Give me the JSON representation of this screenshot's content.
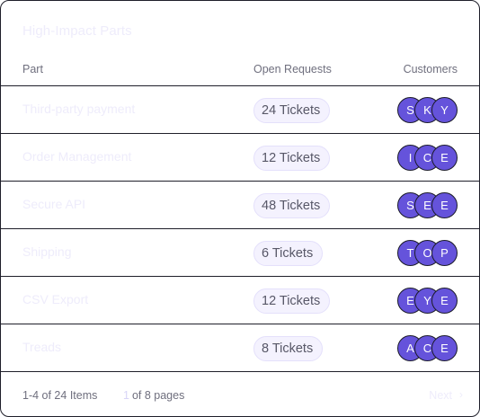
{
  "card": {
    "title": "High-Impact Parts",
    "columns": {
      "part": "Part",
      "requests": "Open Requests",
      "customers": "Customers"
    },
    "rows": [
      {
        "part": "Third-party payment",
        "tickets": "24 Tickets",
        "avatars": [
          "S",
          "K",
          "Y"
        ]
      },
      {
        "part": "Order Management",
        "tickets": "12 Tickets",
        "avatars": [
          "I",
          "C",
          "E"
        ]
      },
      {
        "part": "Secure API",
        "tickets": "48 Tickets",
        "avatars": [
          "S",
          "E",
          "E"
        ]
      },
      {
        "part": "Shipping",
        "tickets": "6 Tickets",
        "avatars": [
          "T",
          "O",
          "P"
        ]
      },
      {
        "part": "CSV Export",
        "tickets": "12 Tickets",
        "avatars": [
          "E",
          "Y",
          "E"
        ]
      },
      {
        "part": "Treads",
        "tickets": "8 Tickets",
        "avatars": [
          "A",
          "C",
          "E"
        ]
      }
    ],
    "footer": {
      "items_summary": "1-4 of 24 Items",
      "current_page": "1",
      "pages_suffix": "of 8 pages",
      "next_label": "Next",
      "next_icon": "chevron-right-icon"
    }
  },
  "colors": {
    "accent": "#6553db",
    "pill_bg": "#f4f2fe",
    "border": "#1f1f2a"
  }
}
